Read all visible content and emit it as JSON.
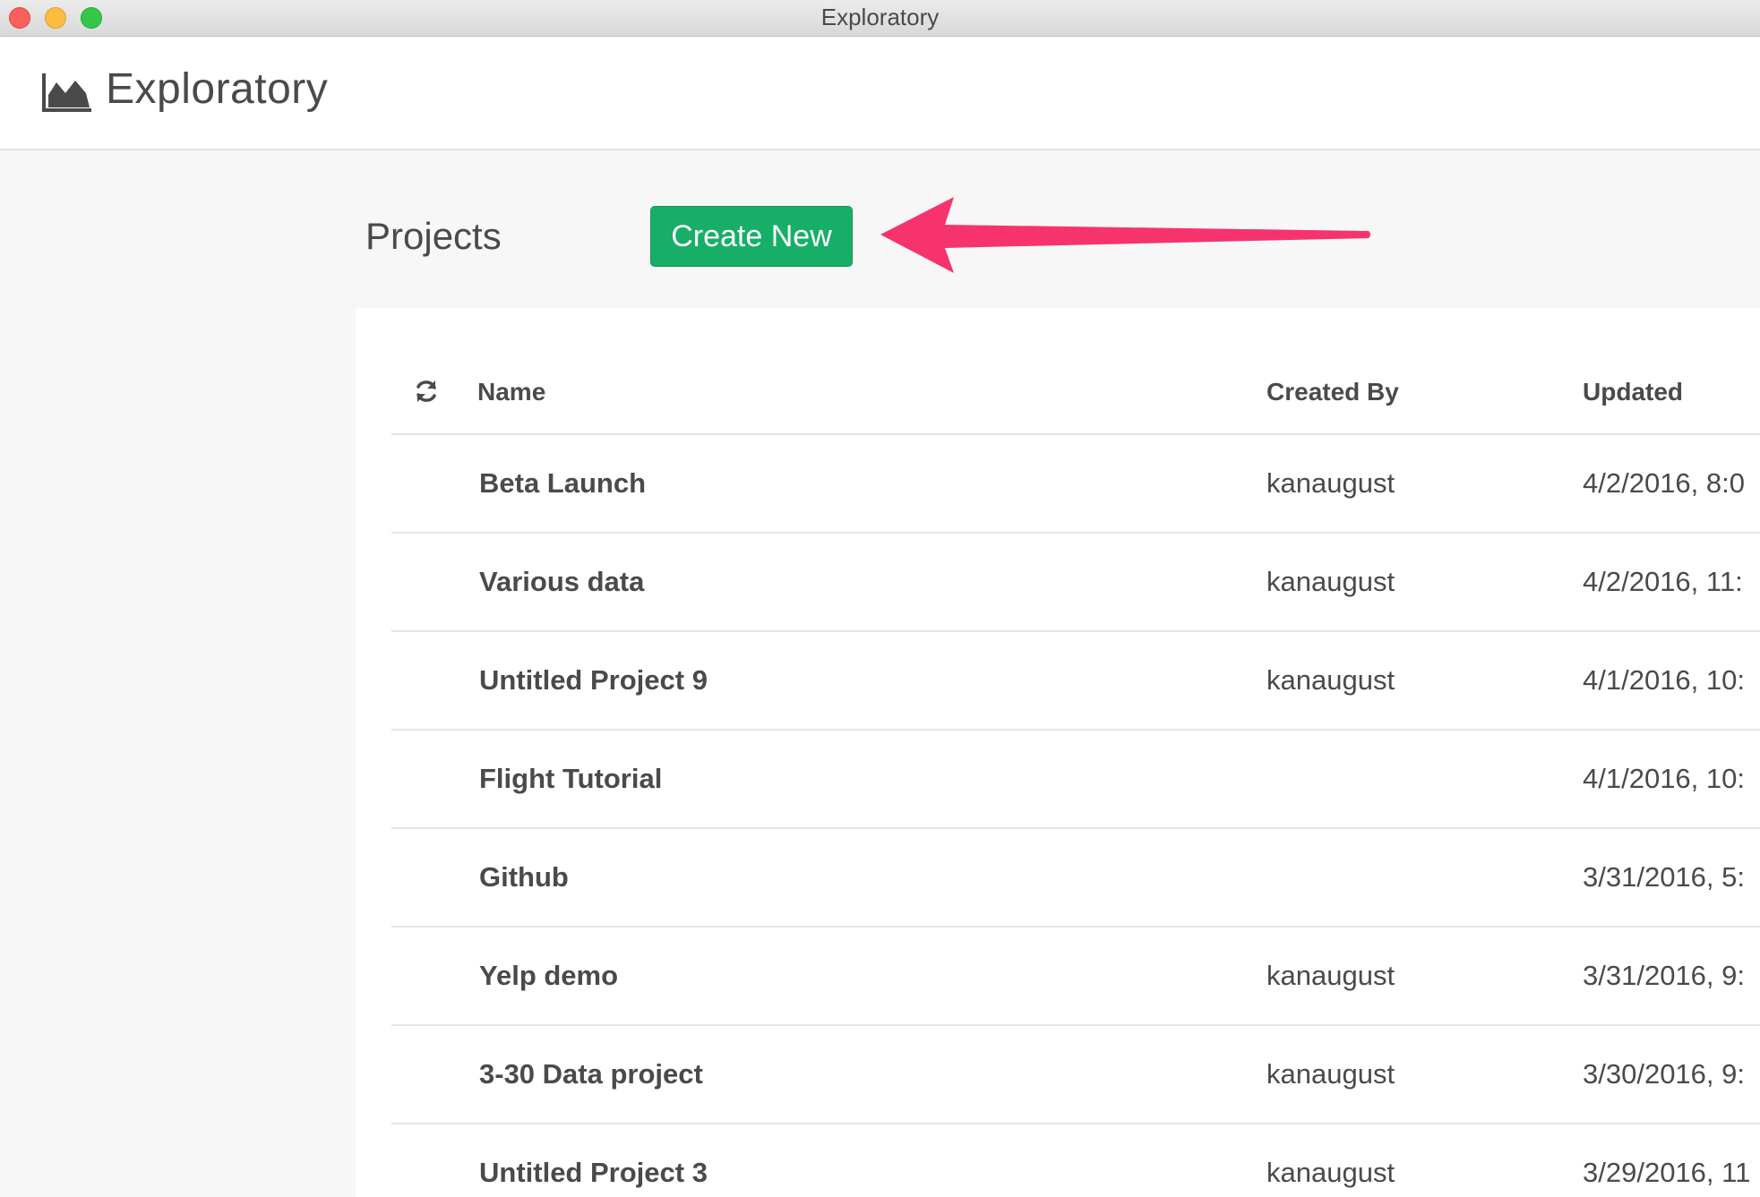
{
  "window": {
    "title": "Exploratory"
  },
  "header": {
    "brand": "Exploratory",
    "logo_icon": "area-chart-icon"
  },
  "projects_bar": {
    "title": "Projects",
    "create_label": "Create New",
    "create_color": "#17ae68",
    "annotation_color": "#f7336e"
  },
  "table": {
    "refresh_icon": "refresh-icon",
    "columns": {
      "name": "Name",
      "created_by": "Created By",
      "updated": "Updated"
    },
    "rows": [
      {
        "name": "Beta Launch",
        "created_by": "kanaugust",
        "updated": "4/2/2016, 8:0"
      },
      {
        "name": "Various data",
        "created_by": "kanaugust",
        "updated": "4/2/2016, 11:"
      },
      {
        "name": "Untitled Project 9",
        "created_by": "kanaugust",
        "updated": "4/1/2016, 10:"
      },
      {
        "name": "Flight Tutorial",
        "created_by": "",
        "updated": "4/1/2016, 10:"
      },
      {
        "name": "Github",
        "created_by": "",
        "updated": "3/31/2016, 5:"
      },
      {
        "name": "Yelp demo",
        "created_by": "kanaugust",
        "updated": "3/31/2016, 9:"
      },
      {
        "name": "3-30 Data project",
        "created_by": "kanaugust",
        "updated": "3/30/2016, 9:"
      },
      {
        "name": "Untitled Project 3",
        "created_by": "kanaugust",
        "updated": "3/29/2016, 11"
      }
    ]
  }
}
